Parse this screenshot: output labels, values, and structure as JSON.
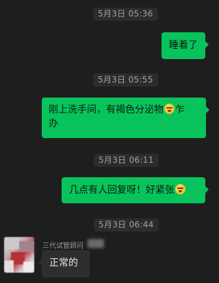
{
  "messages": [
    {
      "time": "5月3日 05:36",
      "text": "睡着了"
    },
    {
      "time": "5月3日 05:55",
      "text_line1": "刚上洗手间，有褐色分泌物",
      "text_line2_suffix": "乍",
      "text_line2": "办"
    },
    {
      "time": "5月3日 06:11",
      "text": "几点有人回复呀！好紧张"
    },
    {
      "time": "5月3日 06:44",
      "sender": "三代试管顾问",
      "text": "正常的"
    }
  ],
  "icons": {
    "emoji_1": "grimace-emoji-icon",
    "emoji_2": "nervous-emoji-icon"
  },
  "colors": {
    "background": "#1e1e1e",
    "outgoing_bubble": "#08c35b",
    "incoming_bubble": "#2e2e2e"
  }
}
